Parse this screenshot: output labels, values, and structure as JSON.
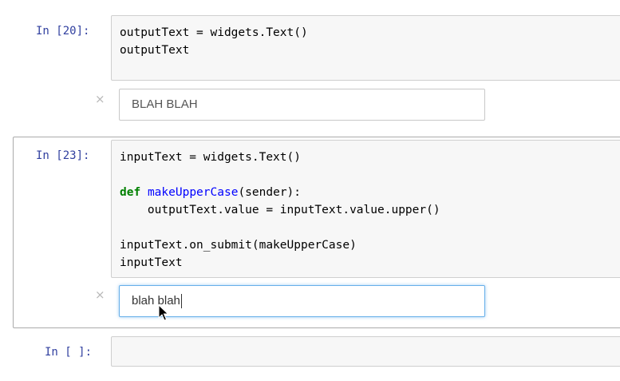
{
  "cells": [
    {
      "prompt": "In [20]:",
      "code_lines": [
        "outputText = widgets.Text()",
        "outputText"
      ],
      "widget_value": "BLAH BLAH",
      "close_symbol": "×"
    },
    {
      "prompt": "In [23]:",
      "code": {
        "l1": "inputText = widgets.Text()",
        "def_kw": "def",
        "fn_name": "makeUpperCase",
        "def_rest": "(sender):",
        "l3": "    outputText.value = inputText.value.upper()",
        "l4": "inputText.on_submit(makeUpperCase)",
        "l5": "inputText"
      },
      "widget_value": "blah blah",
      "close_symbol": "×"
    },
    {
      "prompt": "In [ ]:"
    }
  ],
  "colors": {
    "prompt": "#303f9f",
    "keyword": "#008000",
    "function_name": "#0000ff",
    "focus_border": "#66afe9"
  },
  "icons": [
    "close-icon",
    "mouse-cursor-icon"
  ]
}
